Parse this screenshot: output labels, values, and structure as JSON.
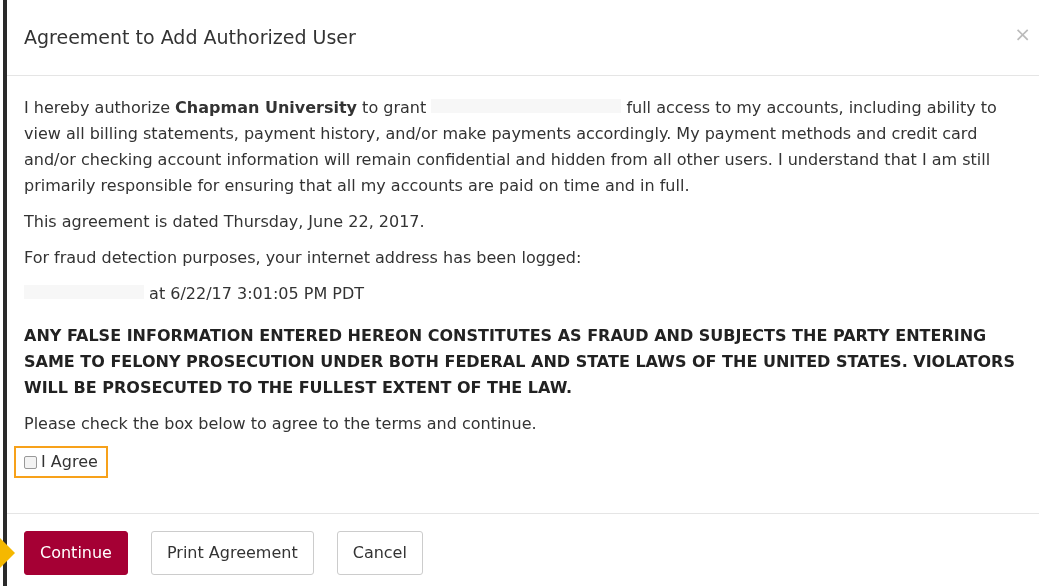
{
  "dialog": {
    "title": "Agreement to Add Authorized User",
    "close": "×"
  },
  "paragraphs": [
    {
      "kind": "redacted",
      "parts": [
        "I hereby authorize **Chapman University** to grant",
        "full access to my accounts, including ability to view all billing statements, payment history, and/or make payments accordingly. My payment methods and credit card and/or checking account information will remain confidential and hidden from all other users. I understand that I am still primarily responsible for ensuring that all my accounts are paid on time and in full."
      ]
    },
    {
      "kind": "plain",
      "parts": [
        "This agreement is dated Thursday, June 22, 2017."
      ]
    },
    {
      "kind": "plain",
      "parts": [
        "For fraud detection purposes, your internet address has been logged:"
      ]
    },
    {
      "kind": "redacted_start",
      "parts": [
        "at 6/22/17 3:01:05 PM PDT"
      ]
    },
    {
      "kind": "warning",
      "parts": [
        "ANY FALSE INFORMATION ENTERED HEREON CONSTITUTES AS FRAUD AND SUBJECTS THE PARTY ENTERING SAME TO FELONY PROSECUTION UNDER BOTH FEDERAL AND STATE LAWS OF THE UNITED STATES. VIOLATORS WILL BE PROSECUTED TO THE FULLEST EXTENT OF THE LAW."
      ]
    },
    {
      "kind": "plain",
      "parts": [
        "Please check the box below to agree to the terms and continue."
      ]
    }
  ],
  "agree": {
    "label": "I Agree",
    "checked": false,
    "highlighted": true
  },
  "buttons": [
    {
      "label": "Continue",
      "kind": "primary",
      "pointed": true
    },
    {
      "label": "Print Agreement",
      "kind": "default",
      "pointed": false
    },
    {
      "label": "Cancel",
      "kind": "default",
      "pointed": false
    }
  ]
}
